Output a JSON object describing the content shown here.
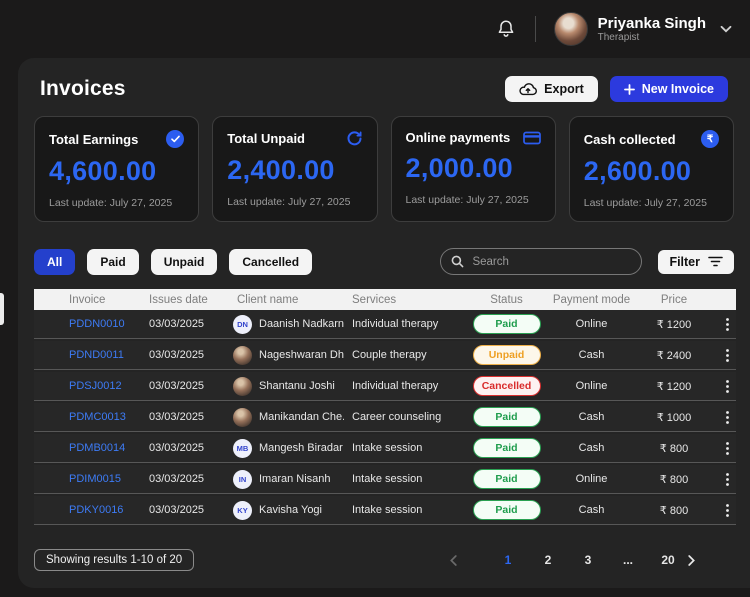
{
  "topbar": {
    "user_name": "Priyanka Singh",
    "user_role": "Therapist"
  },
  "header": {
    "title": "Invoices",
    "export_label": "Export",
    "new_invoice_label": "New Invoice"
  },
  "stats": [
    {
      "label": "Total Earnings",
      "value": "4,600.00",
      "icon": "check-circle-icon",
      "last_update": "Last update: July 27, 2025"
    },
    {
      "label": "Total Unpaid",
      "value": "2,400.00",
      "icon": "refresh-icon",
      "last_update": "Last update: July 27, 2025"
    },
    {
      "label": "Online payments",
      "value": "2,000.00",
      "icon": "credit-card-icon",
      "last_update": "Last update: July 27, 2025"
    },
    {
      "label": "Cash collected",
      "value": "2,600.00",
      "icon": "rupee-circle-icon",
      "last_update": "Last update: July 27, 2025",
      "icon_char": "₹"
    }
  ],
  "filters": {
    "tabs": [
      {
        "label": "All",
        "active": true
      },
      {
        "label": "Paid",
        "active": false
      },
      {
        "label": "Unpaid",
        "active": false
      },
      {
        "label": "Cancelled",
        "active": false
      }
    ],
    "search_placeholder": "Search",
    "filter_label": "Filter"
  },
  "table": {
    "columns": {
      "invoice": "Invoice",
      "date": "Issues date",
      "client": "Client name",
      "service": "Services",
      "status": "Status",
      "payment": "Payment mode",
      "price": "Price"
    },
    "rows": [
      {
        "invoice": "PDDN0010",
        "date": "03/03/2025",
        "client": "Daanish Nadkarni",
        "avatar": "DN",
        "avatar_type": "initials",
        "service": "Individual therapy",
        "status": "Paid",
        "payment": "Online",
        "price": "₹ 1200"
      },
      {
        "invoice": "PDND0011",
        "date": "03/03/2025",
        "client": "Nageshwaran Dh...",
        "avatar": "",
        "avatar_type": "photo",
        "service": "Couple therapy",
        "status": "Unpaid",
        "payment": "Cash",
        "price": "₹ 2400"
      },
      {
        "invoice": "PDSJ0012",
        "date": "03/03/2025",
        "client": "Shantanu Joshi",
        "avatar": "",
        "avatar_type": "photo",
        "service": "Individual therapy",
        "status": "Cancelled",
        "payment": "Online",
        "price": "₹ 1200"
      },
      {
        "invoice": "PDMC0013",
        "date": "03/03/2025",
        "client": "Manikandan Che...",
        "avatar": "",
        "avatar_type": "photo",
        "service": "Career counseling",
        "status": "Paid",
        "payment": "Cash",
        "price": "₹ 1000"
      },
      {
        "invoice": "PDMB0014",
        "date": "03/03/2025",
        "client": "Mangesh Biradar",
        "avatar": "MB",
        "avatar_type": "initials",
        "service": "Intake session",
        "status": "Paid",
        "payment": "Cash",
        "price": "₹ 800"
      },
      {
        "invoice": "PDIM0015",
        "date": "03/03/2025",
        "client": "Imaran Nisanh",
        "avatar": "IN",
        "avatar_type": "initials",
        "service": "Intake session",
        "status": "Paid",
        "payment": "Online",
        "price": "₹ 800"
      },
      {
        "invoice": "PDKY0016",
        "date": "03/03/2025",
        "client": "Kavisha Yogi",
        "avatar": "KY",
        "avatar_type": "initials",
        "service": "Intake session",
        "status": "Paid",
        "payment": "Cash",
        "price": "₹ 800"
      }
    ]
  },
  "footer": {
    "results_text": "Showing results 1-10 of 20",
    "pages": [
      "1",
      "2",
      "3",
      "...",
      "20"
    ],
    "active_page": "1"
  },
  "colors": {
    "accent_blue": "#2c67f2",
    "primary_button_blue": "#2c3ade",
    "paid_green": "#1f9d4d",
    "unpaid_orange": "#ee9f22",
    "cancelled_red": "#d92c2c"
  }
}
